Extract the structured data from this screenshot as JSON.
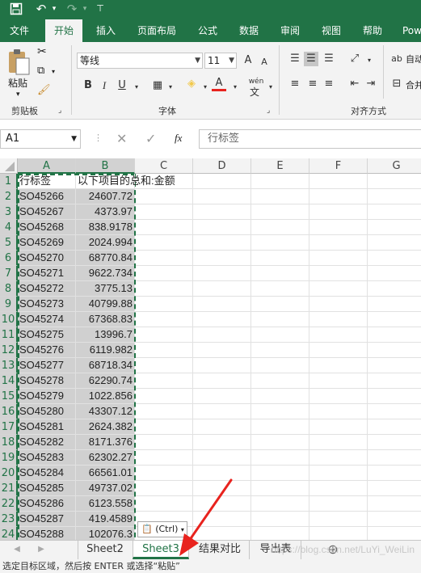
{
  "qat": {
    "save_icon": "save-icon",
    "undo_icon": "undo-icon",
    "redo_icon": "redo-icon",
    "customize_icon": "customize-icon"
  },
  "tabs": [
    {
      "label": "文件",
      "active": false
    },
    {
      "label": "开始",
      "active": true
    },
    {
      "label": "插入",
      "active": false
    },
    {
      "label": "页面布局",
      "active": false
    },
    {
      "label": "公式",
      "active": false
    },
    {
      "label": "数据",
      "active": false
    },
    {
      "label": "审阅",
      "active": false
    },
    {
      "label": "视图",
      "active": false
    },
    {
      "label": "帮助",
      "active": false
    },
    {
      "label": "Pow",
      "active": false
    }
  ],
  "ribbon": {
    "clipboard": {
      "paste_label": "粘贴",
      "group_label": "剪贴板"
    },
    "font": {
      "font_name": "等线",
      "font_size": "11",
      "bold": "B",
      "italic": "I",
      "underline": "U",
      "grow": "A",
      "shrink": "A",
      "font_color_glyph": "A",
      "phonetic": "wén",
      "group_label": "字体"
    },
    "alignment": {
      "wrap_label": "自动",
      "merge_label": "合并",
      "group_label": "对齐方式"
    }
  },
  "formula_bar": {
    "name_box": "A1",
    "fx": "fx",
    "content": "行标签"
  },
  "columns": [
    "A",
    "B",
    "C",
    "D",
    "E",
    "F",
    "G"
  ],
  "rows": [
    {
      "n": "1",
      "a": "行标签",
      "b": "以下项目的总和:金额"
    },
    {
      "n": "2",
      "a": "SO45266",
      "b": "24607.72"
    },
    {
      "n": "3",
      "a": "SO45267",
      "b": "4373.97"
    },
    {
      "n": "4",
      "a": "SO45268",
      "b": "838.9178"
    },
    {
      "n": "5",
      "a": "SO45269",
      "b": "2024.994"
    },
    {
      "n": "6",
      "a": "SO45270",
      "b": "68770.84"
    },
    {
      "n": "7",
      "a": "SO45271",
      "b": "9622.734"
    },
    {
      "n": "8",
      "a": "SO45272",
      "b": "3775.13"
    },
    {
      "n": "9",
      "a": "SO45273",
      "b": "40799.88"
    },
    {
      "n": "10",
      "a": "SO45274",
      "b": "67368.83"
    },
    {
      "n": "11",
      "a": "SO45275",
      "b": "13996.7"
    },
    {
      "n": "12",
      "a": "SO45276",
      "b": "6119.982"
    },
    {
      "n": "13",
      "a": "SO45277",
      "b": "68718.34"
    },
    {
      "n": "14",
      "a": "SO45278",
      "b": "62290.74"
    },
    {
      "n": "15",
      "a": "SO45279",
      "b": "1022.856"
    },
    {
      "n": "16",
      "a": "SO45280",
      "b": "43307.12"
    },
    {
      "n": "17",
      "a": "SO45281",
      "b": "2624.382"
    },
    {
      "n": "18",
      "a": "SO45282",
      "b": "8171.376"
    },
    {
      "n": "19",
      "a": "SO45283",
      "b": "62302.27"
    },
    {
      "n": "20",
      "a": "SO45284",
      "b": "66561.01"
    },
    {
      "n": "21",
      "a": "SO45285",
      "b": "49737.02"
    },
    {
      "n": "22",
      "a": "SO45286",
      "b": "6123.558"
    },
    {
      "n": "23",
      "a": "SO45287",
      "b": "419.4589"
    },
    {
      "n": "24",
      "a": "SO45288",
      "b": "102076.3"
    }
  ],
  "paste_options": "(Ctrl)",
  "sheets": [
    {
      "label": "Sheet2",
      "active": false
    },
    {
      "label": "Sheet3",
      "active": true
    },
    {
      "label": "结果对比",
      "active": false
    },
    {
      "label": "导出表",
      "active": false
    }
  ],
  "add_sheet": "⊕",
  "status": "选定目标区域，然后按 ENTER 或选择“粘贴”",
  "watermark": "https://blog.csdn.net/LuYi_WeiLin",
  "colors": {
    "accent": "#217346",
    "arrow": "#e8231e"
  }
}
